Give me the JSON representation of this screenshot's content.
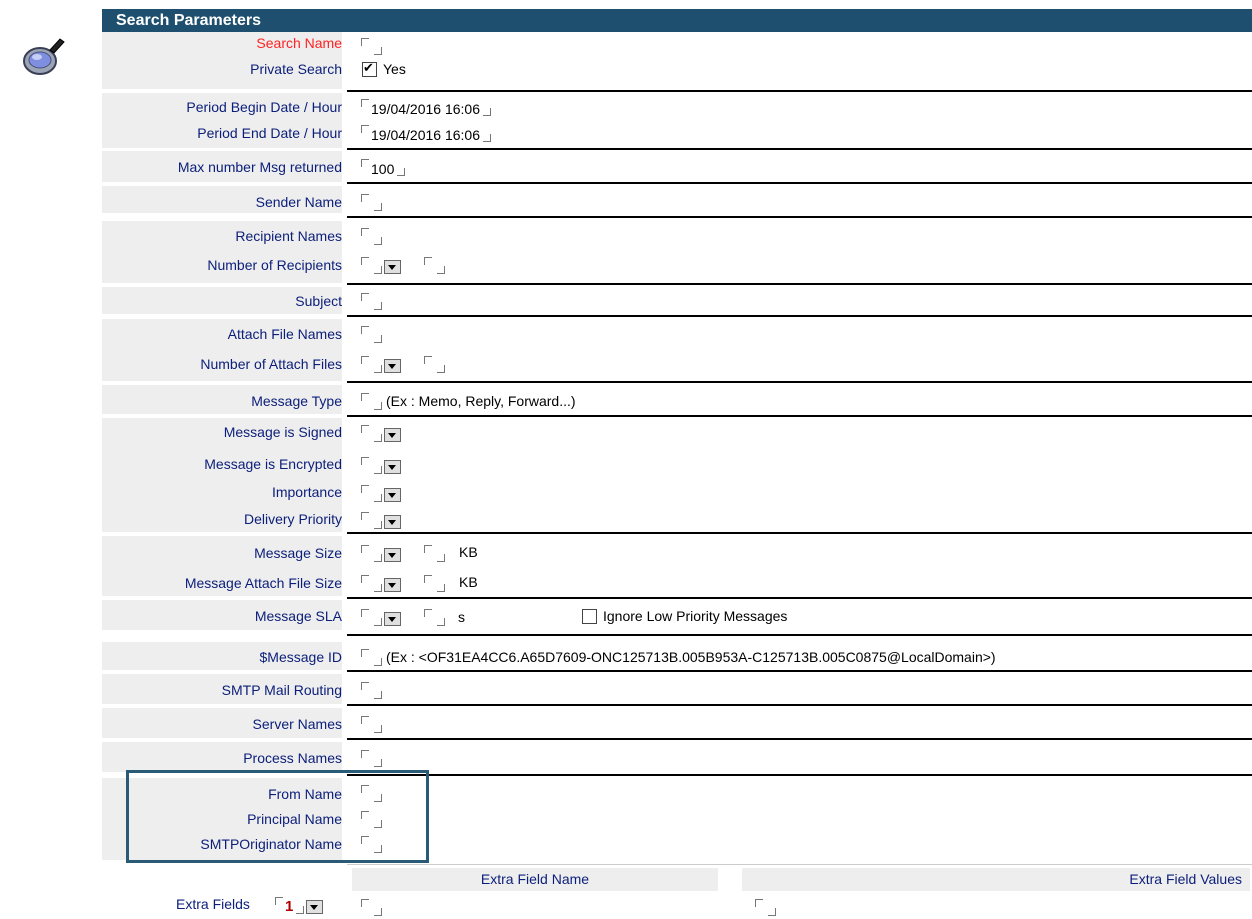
{
  "section_title": "Search Parameters",
  "icons": {
    "search": "magnifier-icon"
  },
  "fields": {
    "search_name": {
      "label": "Search Name",
      "value": ""
    },
    "private_search": {
      "label": "Private Search",
      "checked": true,
      "option": "Yes"
    },
    "period_begin": {
      "label": "Period Begin Date / Hour",
      "value": "19/04/2016 16:06"
    },
    "period_end": {
      "label": "Period End Date / Hour",
      "value": "19/04/2016 16:06"
    },
    "max_msg": {
      "label": "Max number Msg returned",
      "value": "100"
    },
    "sender_name": {
      "label": "Sender Name",
      "value": ""
    },
    "recipient_names": {
      "label": "Recipient Names",
      "value": ""
    },
    "num_recipients": {
      "label": "Number of Recipients",
      "value": ""
    },
    "subject": {
      "label": "Subject",
      "value": ""
    },
    "attach_file_names": {
      "label": "Attach File Names",
      "value": ""
    },
    "num_attach_files": {
      "label": "Number of Attach Files",
      "value": ""
    },
    "message_type": {
      "label": "Message Type",
      "hint": "(Ex : Memo, Reply, Forward...)"
    },
    "message_signed": {
      "label": "Message is Signed"
    },
    "message_encrypted": {
      "label": "Message is Encrypted"
    },
    "importance": {
      "label": "Importance"
    },
    "delivery_priority": {
      "label": "Delivery Priority"
    },
    "message_size": {
      "label": "Message Size",
      "unit": "KB"
    },
    "attach_file_size": {
      "label": "Message Attach File Size",
      "unit": "KB"
    },
    "message_sla": {
      "label": "Message SLA",
      "unit": "s",
      "ignore_low_label": "Ignore Low Priority Messages",
      "ignore_low_checked": false
    },
    "message_id": {
      "label": "$Message ID",
      "hint": "(Ex : <OF31EA4CC6.A65D7609-ONC125713B.005B953A-C125713B.005C0875@LocalDomain>)"
    },
    "smtp_routing": {
      "label": "SMTP Mail Routing"
    },
    "server_names": {
      "label": "Server Names"
    },
    "process_names": {
      "label": "Process Names"
    },
    "from_name": {
      "label": "From Name"
    },
    "principal_name": {
      "label": "Principal Name"
    },
    "smtp_originator": {
      "label": "SMTPOriginator Name"
    }
  },
  "extra": {
    "col_name": "Extra Field Name",
    "col_values": "Extra Field Values",
    "label": "Extra Fields",
    "count": "1"
  }
}
